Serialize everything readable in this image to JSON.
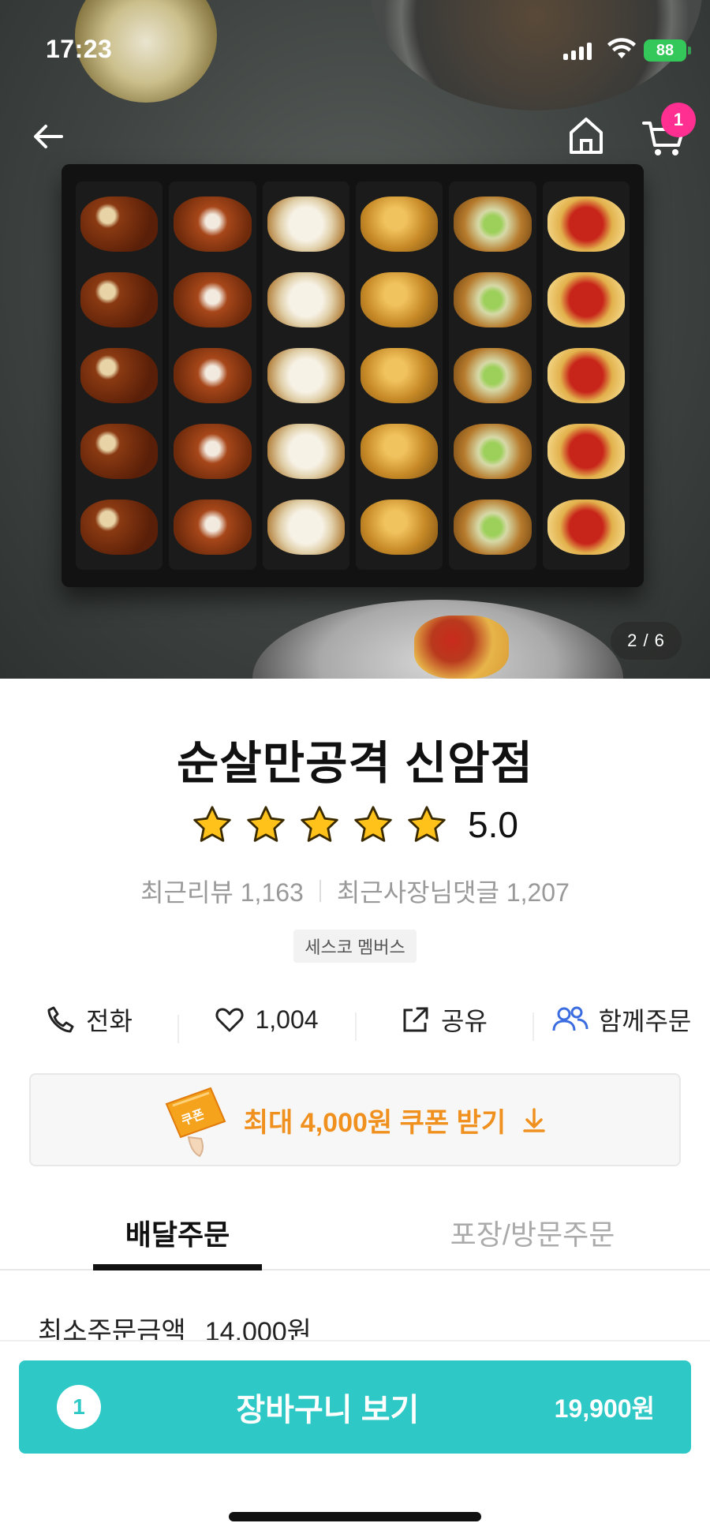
{
  "status_bar": {
    "time": "17:23",
    "battery": "88"
  },
  "hero": {
    "image_counter": "2 / 6",
    "cart_badge": "1"
  },
  "store": {
    "name": "순살만공격 신암점",
    "rating": "5.0",
    "stars": 5,
    "recent_reviews_label": "최근리뷰",
    "recent_reviews_count": "1,163",
    "owner_replies_label": "최근사장님댓글",
    "owner_replies_count": "1,207",
    "tag": "세스코 멤버스"
  },
  "actions": {
    "call": "전화",
    "like_count": "1,004",
    "share": "공유",
    "group_order": "함께주문"
  },
  "coupon": {
    "icon_label": "쿠폰",
    "text": "최대 4,000원 쿠폰 받기"
  },
  "tabs": [
    {
      "label": "배달주문",
      "active": true
    },
    {
      "label": "포장/방문주문",
      "active": false
    }
  ],
  "min_order": {
    "label": "최소주문금액",
    "value": "14,000원"
  },
  "cart_bar": {
    "count": "1",
    "label": "장바구니 보기",
    "total": "19,900원"
  },
  "colors": {
    "accent": "#2ec9c6",
    "coupon": "#f0901e",
    "badge": "#ff2f92",
    "group_icon": "#3b6de0",
    "star": "#ffc21a"
  }
}
